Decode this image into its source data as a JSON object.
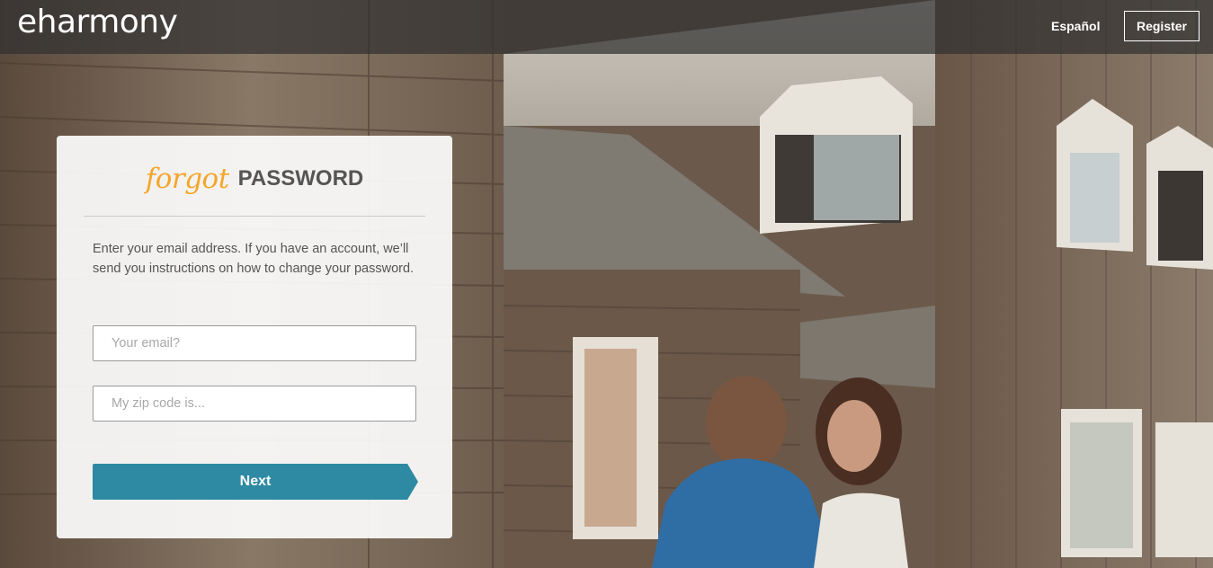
{
  "header": {
    "logo_text": "eharmony",
    "language_link": "Español",
    "register_label": "Register"
  },
  "card": {
    "title_script": "forgot",
    "title_main": "PASSWORD",
    "instructions": "Enter your email address. If you have an account, we’ll send you instructions on how to change your password.",
    "email_field": {
      "value": "",
      "placeholder": "Your email?"
    },
    "zip_field": {
      "value": "",
      "placeholder": "My zip code is..."
    },
    "next_label": "Next"
  },
  "colors": {
    "accent_teal": "#2e8aa3",
    "script_orange": "#f4a62a",
    "header_overlay": "#303030"
  },
  "background": {
    "description_icon": "couple-photo-background"
  }
}
